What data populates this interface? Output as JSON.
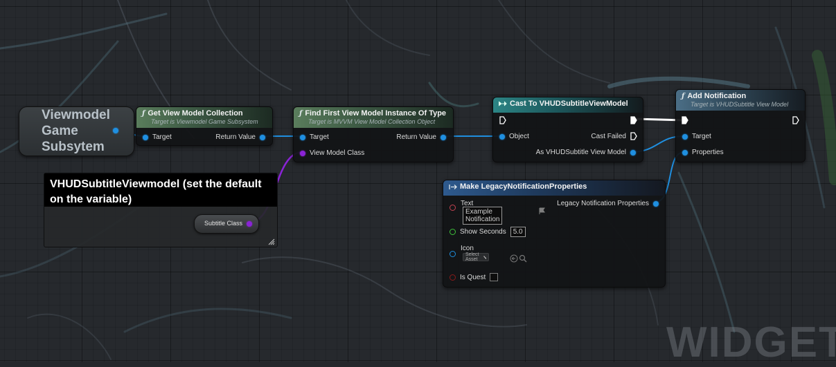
{
  "graph": {
    "watermark": "WIDGET B"
  },
  "getter_node": {
    "label": "Viewmodel\nGame\nSubsytem"
  },
  "comment_box": {
    "text": "VHUDSubtitleViewmodel (set the default on the variable)"
  },
  "variable_node": {
    "label": "Subtitle Class"
  },
  "node_get_collection": {
    "title": "Get View Model Collection",
    "subtitle": "Target is Viewmodel Game Subsystem",
    "input_target": "Target",
    "output_return": "Return Value"
  },
  "node_find_first": {
    "title": "Find First View Model Instance Of Type",
    "subtitle": "Target is MVVM View Model Collection Object",
    "input_target": "Target",
    "input_class": "View Model Class",
    "output_return": "Return Value"
  },
  "node_cast": {
    "title": "Cast To VHUDSubtitleViewModel",
    "input_object": "Object",
    "output_failed": "Cast Failed",
    "output_as": "As VHUDSubtitle View Model"
  },
  "node_add_notification": {
    "title": "Add Notification",
    "subtitle": "Target is VHUDSubtitle View Model",
    "input_target": "Target",
    "input_properties": "Properties"
  },
  "node_make_props": {
    "title": "Make LegacyNotificationProperties",
    "output": "Legacy Notification Properties",
    "text_label": "Text",
    "text_value": "Example Notification",
    "show_seconds_label": "Show Seconds",
    "show_seconds_value": "5.0",
    "icon_label": "Icon",
    "icon_placeholder": "Select Asset",
    "is_quest_label": "Is Quest",
    "is_quest_checked": false
  },
  "colors": {
    "object_pin": "#1f8fe0",
    "class_pin": "#8a23d6",
    "text_pin": "#c64352",
    "float_pin": "#3fc23b",
    "bool_pin": "#8c1a1a",
    "wire_object": "#1f8fe0",
    "wire_class": "#8a23d6"
  }
}
